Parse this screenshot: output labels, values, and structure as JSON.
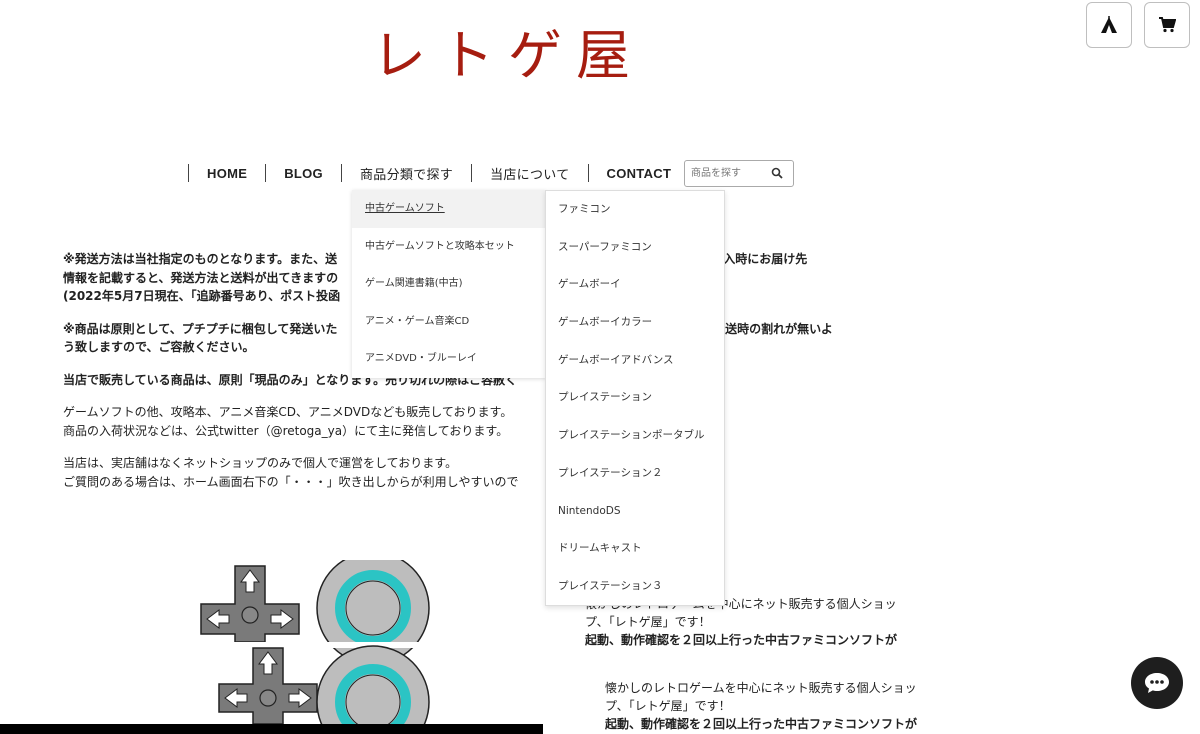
{
  "site": {
    "logo_text": "レトゲ屋",
    "logo_color": "#a61d10"
  },
  "header_icons": {
    "tent": "tent-icon",
    "cart": "cart-icon"
  },
  "nav": {
    "items": [
      "HOME",
      "BLOG",
      "商品分類で探す",
      "当店について",
      "CONTACT"
    ],
    "search_placeholder": "商品を探す"
  },
  "dropdown_primary": [
    "中古ゲームソフト",
    "中古ゲームソフトと攻略本セット",
    "ゲーム関連書籍(中古)",
    "アニメ・ゲーム音楽CD",
    "アニメDVD・ブルーレイ"
  ],
  "dropdown_secondary": [
    "ファミコン",
    "スーパーファミコン",
    "ゲームボーイ",
    "ゲームボーイカラー",
    "ゲームボーイアドバンス",
    "プレイステーション",
    "プレイステーションポータブル",
    "プレイステーション２",
    "NintendoDS",
    "ドリームキャスト",
    "プレイステーション３"
  ],
  "notice": {
    "p1_l1": "※発送方法は当社指定のものとなります。また、送",
    "p1_l1_right": "しております。購入時にお届け先",
    "p1_l2": "情報を記載すると、発送方法と送料が出てきますの",
    "p1_l3": "(2022年5月7日現在、「追跡番号あり、ポスト投函",
    "p2_l1": "※商品は原則として、プチプチに梱包して発送いた",
    "p2_l1_right": "きうる限り発送時の割れが無いよ",
    "p2_l2": "う致しますので、ご容赦ください。",
    "p3_l1": "当店で販売している商品は、原則「現品のみ」となります。売り切れの際はご容赦く",
    "p4_l1": "ゲームソフトの他、攻略本、アニメ音楽CD、アニメDVDなども販売しております。",
    "p4_l2": "商品の入荷状況などは、公式twitter（@retoga_ya）にて主に発信しております。",
    "p5_l1": "当店は、実店舗はなくネットショップのみで個人で運営をしております。",
    "p5_l2": "ご質問のある場合は、ホーム画面右下の「・・・」吹き出しからが利用しやすいので"
  },
  "about": {
    "l1": "懐かしのレトロゲームを中心にネット販売する個人ショッ",
    "l2": "プ、「レトゲ屋」です！",
    "l3": "起動、動作確認を２回以上行った中古ファミコンソフトが"
  },
  "chat": {
    "icon": "chat-bubble-icon"
  }
}
